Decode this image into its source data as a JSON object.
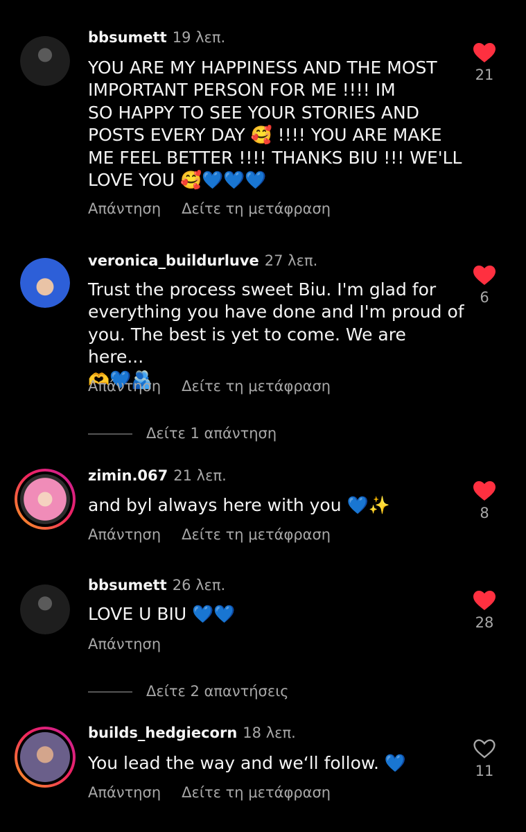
{
  "comments": [
    {
      "username": "bbsumett",
      "time": "19 λεπ.",
      "text": "YOU ARE MY HAPPINESS AND THE MOST\nIMPORTANT PERSON FOR ME !!!! IM\nSO HAPPY TO SEE YOUR STORIES AND\nPOSTS EVERY DAY 🥰 !!!! YOU ARE MAKE\nME FEEL BETTER !!!! THANKS BIU !!! WE'LL\nLOVE YOU 🥰💙💙💙",
      "reply": "Απάντηση",
      "translate": "Δείτε τη μετάφραση",
      "likes": "21",
      "liked": true
    },
    {
      "username": "veronica_buildurluve",
      "time": "27 λεπ.",
      "text": "Trust the process sweet Biu. I'm glad for\neverything you have done and I'm proud of\nyou. The best is yet to come. We are here...\n🫶💙🫂",
      "reply": "Απάντηση",
      "translate": "Δείτε τη μετάφραση",
      "likes": "6",
      "liked": true,
      "view_replies": "Δείτε 1 απάντηση"
    },
    {
      "username": "zimin.067",
      "time": "21 λεπ.",
      "text": "and byl always here with you 💙✨",
      "reply": "Απάντηση",
      "translate": "Δείτε τη μετάφραση",
      "likes": "8",
      "liked": true
    },
    {
      "username": "bbsumett",
      "time": "26 λεπ.",
      "text": "LOVE U BIU 💙💙",
      "reply": "Απάντηση",
      "likes": "28",
      "liked": true,
      "view_replies": "Δείτε 2 απαντήσεις"
    },
    {
      "username": "builds_hedgiecorn",
      "time": "18 λεπ.",
      "text": "You lead the way and we‘ll follow. 💙",
      "reply": "Απάντηση",
      "translate": "Δείτε τη μετάφραση",
      "likes": "11",
      "liked": false
    }
  ],
  "colors": {
    "background": "#000000",
    "heart_liked": "#ff3040",
    "muted_text": "#a8a8a8"
  },
  "icons": {
    "liked": "heart-filled-icon",
    "unliked": "heart-outline-icon"
  }
}
